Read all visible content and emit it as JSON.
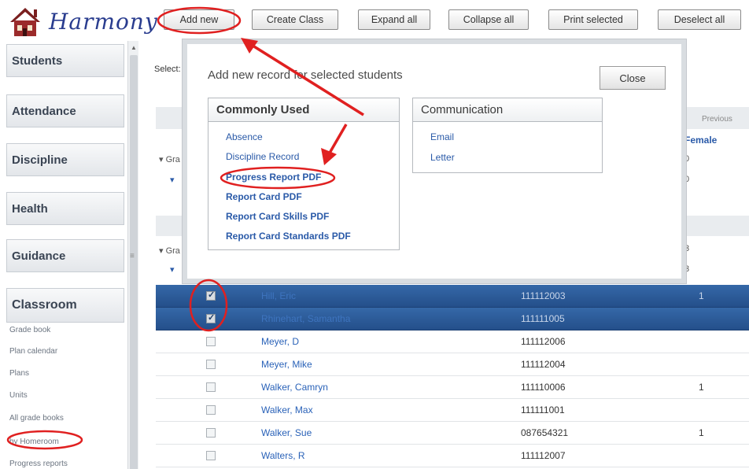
{
  "app": {
    "name": "Harmony"
  },
  "toolbar": {
    "add_new": "Add new",
    "create_class": "Create Class",
    "expand_all": "Expand all",
    "collapse_all": "Collapse all",
    "print_selected": "Print selected",
    "deselect_all": "Deselect all"
  },
  "sidebar": {
    "sections": [
      "Students",
      "Attendance",
      "Discipline",
      "Health",
      "Guidance",
      "Classroom"
    ],
    "links": [
      "Grade book",
      "Plan calendar",
      "Plans",
      "Units",
      "All grade books",
      "by Homeroom",
      "Progress reports"
    ]
  },
  "main": {
    "select_label": "Select:",
    "previous": "Previous",
    "female_header": "Female",
    "group_fragment": "Gra",
    "side_values": [
      "0",
      "0",
      "3",
      "3"
    ],
    "rows": [
      {
        "name": "Hill, Eric",
        "id": "111112003",
        "num": "1",
        "checked": true,
        "selected": true
      },
      {
        "name": "Rhinehart, Samantha",
        "id": "111111005",
        "num": "",
        "checked": true,
        "selected": true
      },
      {
        "name": "Meyer, D",
        "id": "111112006",
        "num": "",
        "checked": false,
        "selected": false
      },
      {
        "name": "Meyer, Mike",
        "id": "111112004",
        "num": "",
        "checked": false,
        "selected": false
      },
      {
        "name": "Walker, Camryn",
        "id": "111110006",
        "num": "1",
        "checked": false,
        "selected": false
      },
      {
        "name": "Walker, Max",
        "id": "111111001",
        "num": "",
        "checked": false,
        "selected": false
      },
      {
        "name": "Walker, Sue",
        "id": "087654321",
        "num": "1",
        "checked": false,
        "selected": false
      },
      {
        "name": "Walters, R",
        "id": "111112007",
        "num": "",
        "checked": false,
        "selected": false
      }
    ]
  },
  "dialog": {
    "title": "Add new record for selected students",
    "close": "Close",
    "commonly_used": {
      "title": "Commonly Used",
      "items": [
        "Absence",
        "Discipline Record",
        "Progress Report PDF",
        "Report Card PDF",
        "Report Card Skills PDF",
        "Report Card Standards PDF"
      ]
    },
    "communication": {
      "title": "Communication",
      "items": [
        "Email",
        "Letter"
      ]
    }
  },
  "colors": {
    "accent_blue": "#2a5aa8",
    "selected_row": "#2c5b96",
    "annotation_red": "#e02020"
  }
}
